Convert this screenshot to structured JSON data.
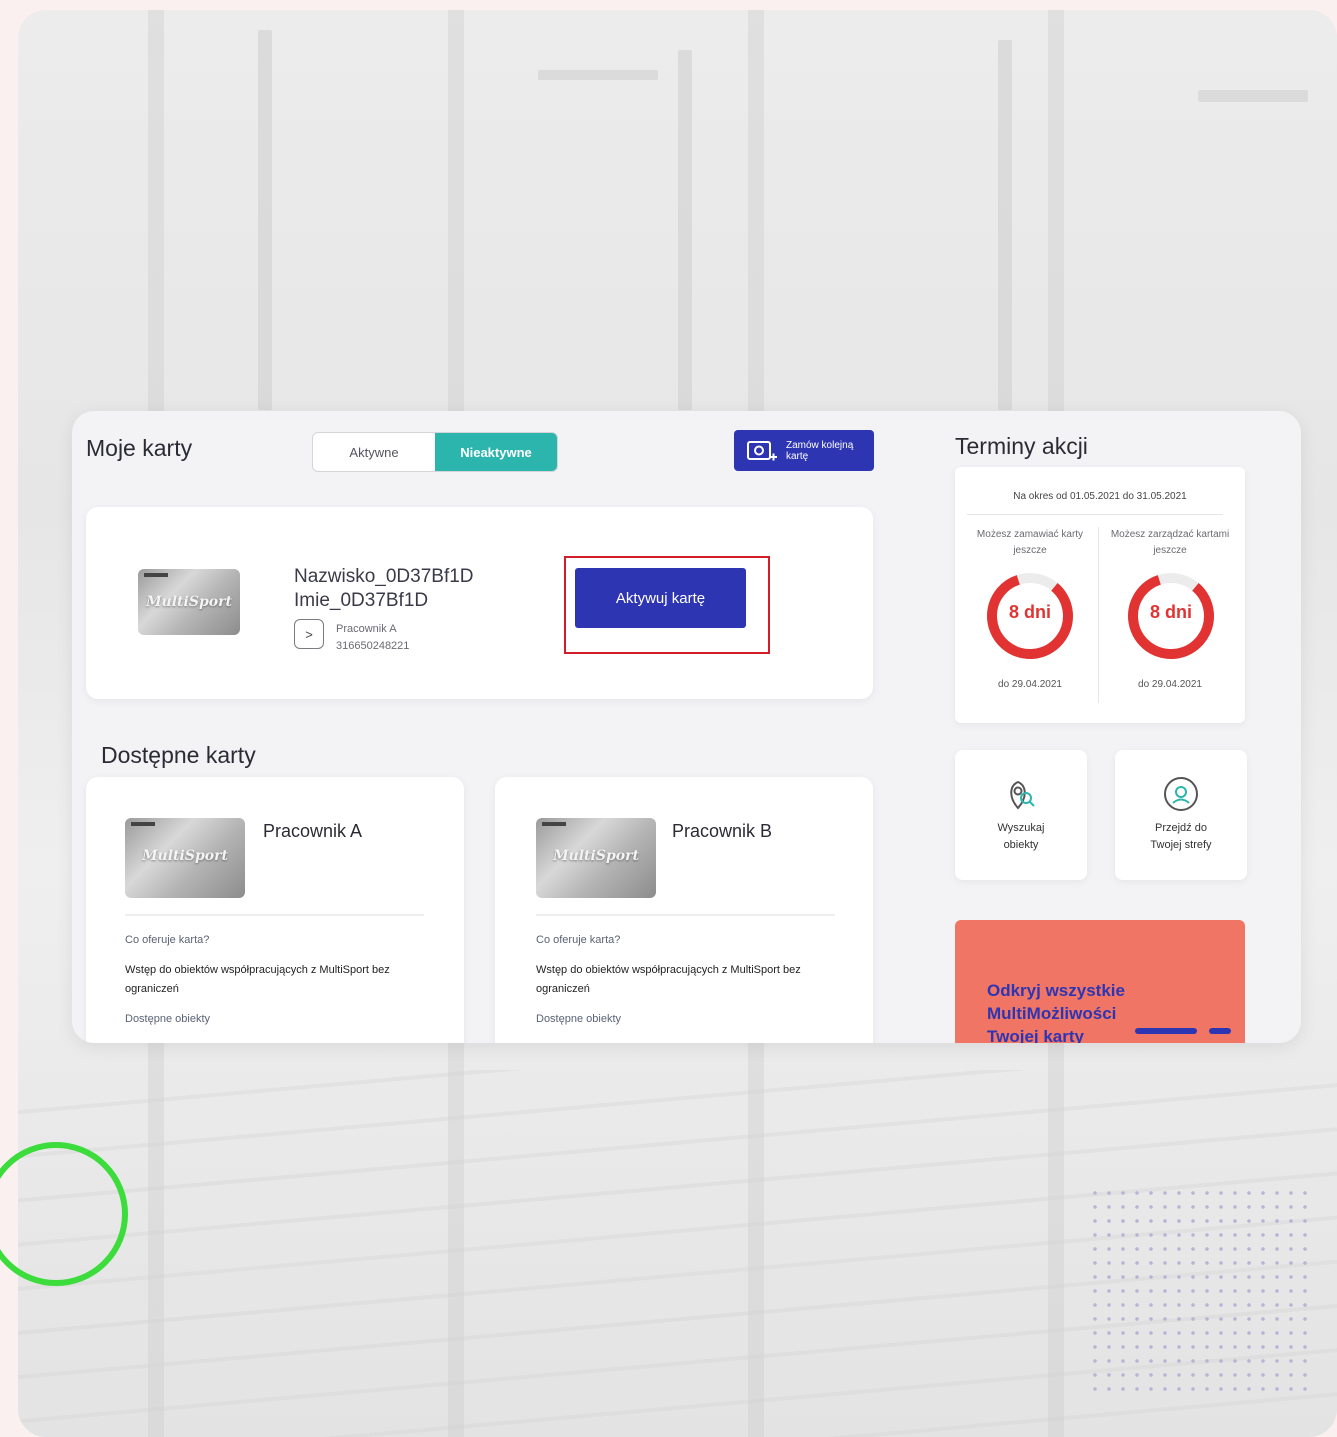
{
  "my_cards": {
    "title": "Moje karty",
    "tabs": [
      {
        "label": "Aktywne",
        "active": false
      },
      {
        "label": "Nieaktywne",
        "active": true
      }
    ],
    "order_button_label": "Zamów kolejną kartę",
    "current_card": {
      "holder_name": "Nazwisko_0D37Bf1D Imie_0D37Bf1D",
      "card_type": "Pracownik A",
      "card_number": "316650248221",
      "activate_label": "Aktywuj kartę"
    }
  },
  "available_cards": {
    "title": "Dostępne karty",
    "items": [
      {
        "name": "Pracownik A",
        "question": "Co oferuje karta?",
        "description": "Wstęp do obiektów współpracujących z MultiSport bez ograniczeń",
        "facilities_label": "Dostępne obiekty"
      },
      {
        "name": "Pracownik B",
        "question": "Co oferuje karta?",
        "description": "Wstęp do obiektów współpracujących z MultiSport bez ograniczeń",
        "facilities_label": "Dostępne obiekty"
      }
    ]
  },
  "card_brand": "MultiSport",
  "terms": {
    "title": "Terminy akcji",
    "period": "Na okres od 01.05.2021 do 31.05.2021",
    "columns": [
      {
        "caption": "Możesz zamawiać karty jeszcze",
        "value": "8 dni",
        "until": "do 29.04.2021"
      },
      {
        "caption": "Możesz zarządzać kartami jeszcze",
        "value": "8 dni",
        "until": "do 29.04.2021"
      }
    ]
  },
  "tiles": [
    {
      "label": "Wyszukaj obiekty",
      "icon": "location-search-icon"
    },
    {
      "label": "Przejdź do Twojej strefy",
      "icon": "user-zone-icon"
    }
  ],
  "promo": {
    "text": "Odkryj wszystkie MultiMożliwości Twojej karty"
  },
  "colors": {
    "primary": "#2e35b3",
    "teal": "#2bb5ad",
    "highlight_red": "#d21d2a",
    "ring_red": "#e23333",
    "promo_bg": "#f07565",
    "accent_green": "#3ddc3d"
  }
}
